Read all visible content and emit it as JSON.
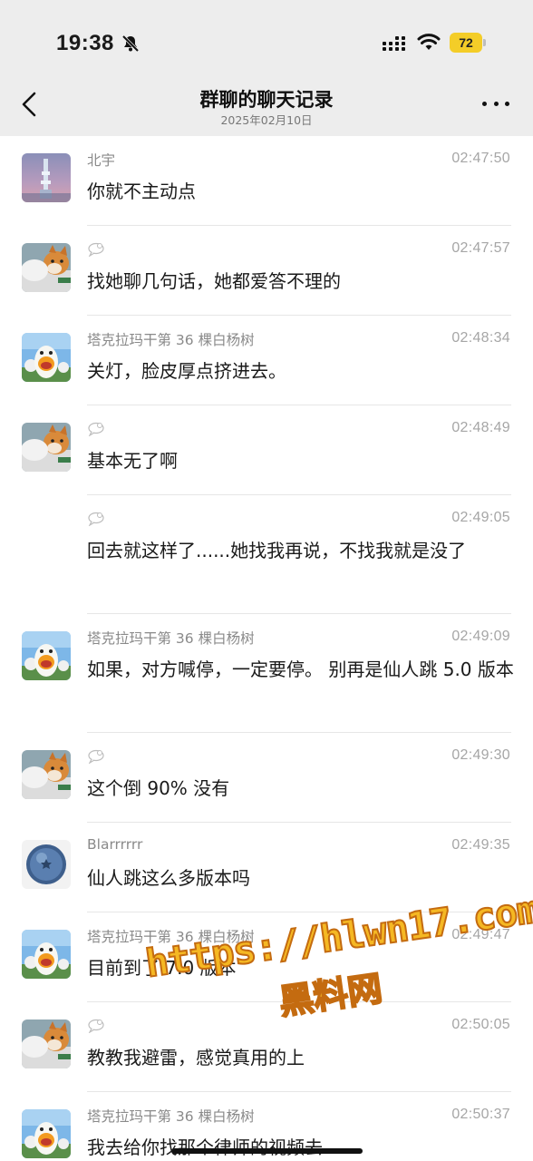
{
  "status_bar": {
    "time": "19:38",
    "battery_level": "72",
    "battery_color": "#f4cd28"
  },
  "nav": {
    "title": "群聊的聊天记录",
    "subtitle": "2025年02月10日"
  },
  "messages": [
    {
      "avatar": "avatar-tower",
      "sender": "北宇",
      "bubble": false,
      "time": "02:47:50",
      "text": "你就不主动点"
    },
    {
      "avatar": "avatar-shiba",
      "sender": "",
      "bubble": true,
      "time": "02:47:57",
      "text": "找她聊几句话，她都爱答不理的"
    },
    {
      "avatar": "avatar-duck",
      "sender": "塔克拉玛干第 36 棵白杨树",
      "bubble": false,
      "time": "02:48:34",
      "text": "关灯，脸皮厚点挤进去。"
    },
    {
      "avatar": "avatar-shiba",
      "sender": "",
      "bubble": true,
      "time": "02:48:49",
      "text": "基本无了啊"
    },
    {
      "avatar": "none",
      "sender": "",
      "bubble": true,
      "time": "02:49:05",
      "text": "回去就这样了......她找我再说，不找我就是没了"
    },
    {
      "avatar": "avatar-duck",
      "sender": "塔克拉玛干第 36 棵白杨树",
      "bubble": false,
      "time": "02:49:09",
      "text": "如果，对方喊停，一定要停。 别再是仙人跳 5.0 版本"
    },
    {
      "avatar": "avatar-shiba",
      "sender": "",
      "bubble": true,
      "time": "02:49:30",
      "text": "这个倒 90% 没有"
    },
    {
      "avatar": "avatar-blueberry",
      "sender": "Blarrrrrr",
      "bubble": false,
      "time": "02:49:35",
      "text": "仙人跳这么多版本吗"
    },
    {
      "avatar": "avatar-duck",
      "sender": "塔克拉玛干第 36 棵白杨树",
      "bubble": false,
      "time": "02:49:47",
      "text": "目前到了 7.0 版本"
    },
    {
      "avatar": "avatar-shiba",
      "sender": "",
      "bubble": true,
      "time": "02:50:05",
      "text": "教教我避雷，感觉真用的上"
    },
    {
      "avatar": "avatar-duck",
      "sender": "塔克拉玛干第 36 棵白杨树",
      "bubble": false,
      "time": "02:50:37",
      "text": "我去给你找那个律师的视频去"
    }
  ],
  "watermark": {
    "line1": "https://hlwn17.com",
    "line2": "黑料网"
  }
}
